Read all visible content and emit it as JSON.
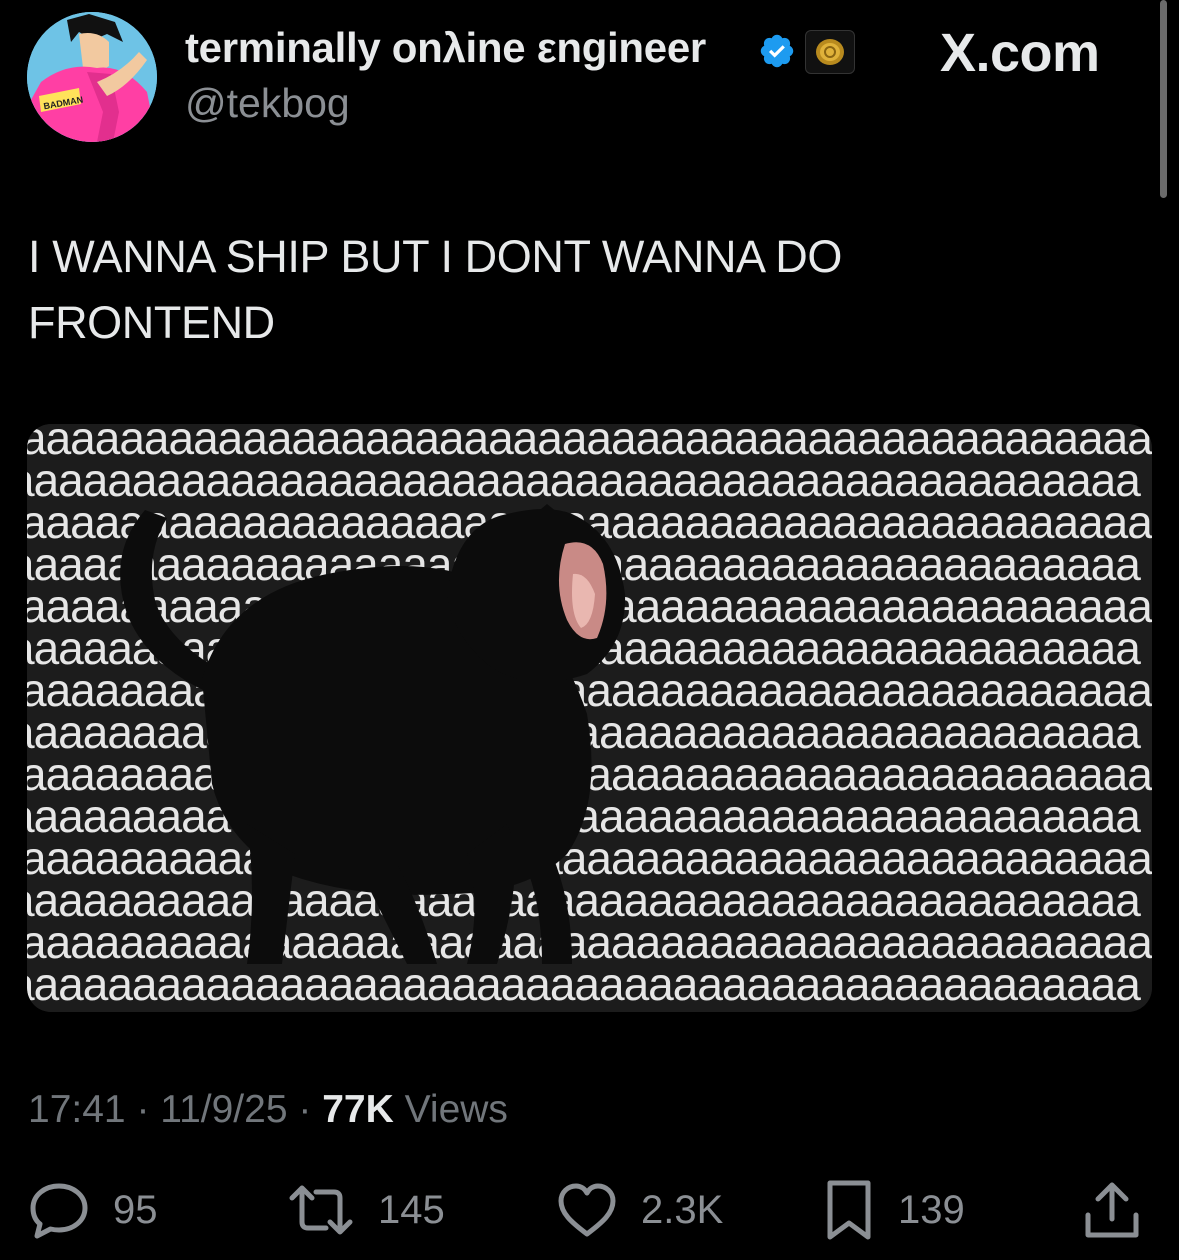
{
  "author": {
    "display_name": "terminally onλine εngineer",
    "handle": "@tekbog",
    "avatar_text": "BADMAN",
    "verified_icon": "verified-badge-icon",
    "org_badge_icon": "gold-coin-icon"
  },
  "site_label": "X.com",
  "tweet": {
    "text": "I WANNA SHIP BUT I DONT WANNA DO\nFRONTEND"
  },
  "media": {
    "background_letter": "a",
    "description_icon": "black-cat-screaming"
  },
  "meta": {
    "time": "17:41",
    "separator": "·",
    "date": "11/9/25",
    "views_count": "77K",
    "views_label": "Views"
  },
  "actions": {
    "replies": "95",
    "reposts": "145",
    "likes": "2.3K",
    "bookmarks": "139"
  },
  "colors": {
    "background": "#000000",
    "text_primary": "#e7e9ea",
    "text_secondary": "#71767b",
    "verified_blue": "#1d9bf0",
    "avatar_shirt": "#ff3fa4",
    "avatar_bg": "#6ec3e6"
  }
}
